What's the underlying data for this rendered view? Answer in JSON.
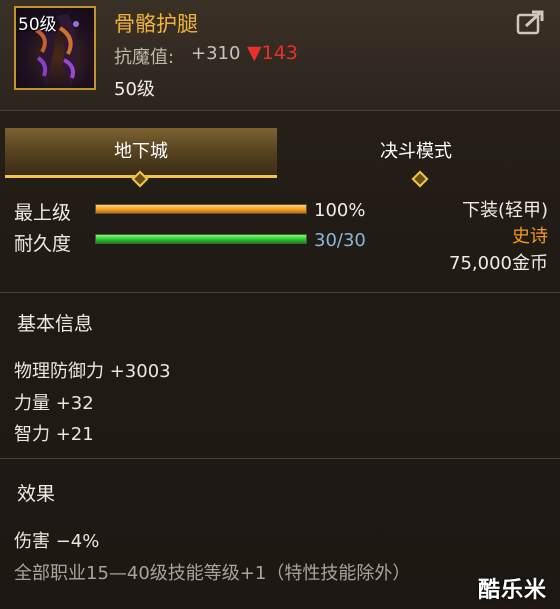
{
  "item": {
    "level_tag": "50级",
    "name": "骨骼护腿",
    "resist_label": "抗魔值:",
    "resist_value": "+310",
    "resist_change": "▼143",
    "required_level": "50级"
  },
  "tabs": [
    {
      "label": "地下城",
      "active": true
    },
    {
      "label": "决斗模式",
      "active": false
    }
  ],
  "stats": {
    "grade_label": "最上级",
    "grade_value": "100%",
    "grade_fraction": 1.0,
    "durability_label": "耐久度",
    "durability_value": "30/30",
    "durability_fraction": 1.0
  },
  "right_info": {
    "slot": "下装(轻甲)",
    "rarity": "史诗",
    "price": "75,000金币"
  },
  "basic_info": {
    "title": "基本信息",
    "lines": [
      "物理防御力 +3003",
      "力量 +32",
      "智力 +21"
    ]
  },
  "effects": {
    "title": "效果",
    "lines": [
      "伤害 −4%",
      "全部职业15—40级技能等级+1（特性技能除外）"
    ]
  },
  "watermark": "酷乐米",
  "colors": {
    "accent_gold": "#f2c44b",
    "item_name": "#f1b43a",
    "rarity": "#f29a1e",
    "resist_down": "#e8312b",
    "durability_value": "#8fb4d8"
  },
  "icons": [
    "share-icon",
    "diamond-icon"
  ]
}
